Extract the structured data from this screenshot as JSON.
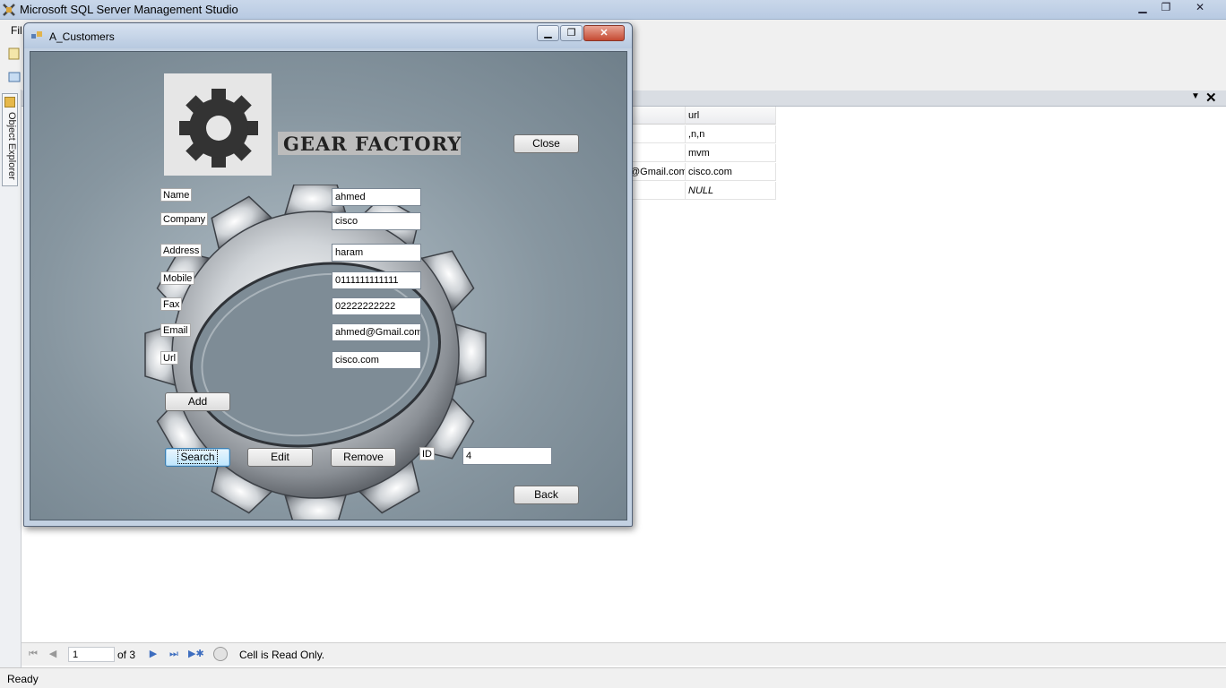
{
  "ssms": {
    "title": "Microsoft SQL Server Management Studio",
    "menu_first": "Fil",
    "object_explorer_tab": "Object Explorer",
    "window_controls": {
      "minimize": "▁",
      "maximize": "❐",
      "close": "✕"
    }
  },
  "results": {
    "header_url": "url",
    "rows": [
      {
        "email": "",
        "url": ",n,n"
      },
      {
        "email": "",
        "url": "mvm"
      },
      {
        "email": "@Gmail.com",
        "url": "cisco.com"
      },
      {
        "email": "",
        "url": "NULL"
      }
    ],
    "doc_close": "✕",
    "doc_pin": "▼"
  },
  "navigation": {
    "current_page": "1",
    "of_pages": "of 3",
    "message": "Cell is Read Only."
  },
  "status": {
    "text": "Ready"
  },
  "form": {
    "title": "A_Customers",
    "brand": "GEAR FACTORY",
    "close_button": "Close",
    "back_button": "Back",
    "add_button": "Add",
    "search_button": "Search",
    "edit_button": "Edit",
    "remove_button": "Remove",
    "fields": {
      "name": {
        "label": "Name",
        "value": "ahmed"
      },
      "company": {
        "label": "Company",
        "value": "cisco"
      },
      "address": {
        "label": "Address",
        "value": "haram"
      },
      "mobile": {
        "label": "Mobile",
        "value": "0111111111111"
      },
      "fax": {
        "label": "Fax",
        "value": "02222222222"
      },
      "email": {
        "label": "Email",
        "value": "ahmed@Gmail.com"
      },
      "url": {
        "label": "Url",
        "value": "cisco.com"
      },
      "id": {
        "label": "ID",
        "value": "4"
      }
    }
  },
  "colors": {
    "form_background": "#8796a0",
    "titlebar": "#c3d1e2",
    "close_red": "#c54a32",
    "nav_blue": "#3d6dbf"
  }
}
